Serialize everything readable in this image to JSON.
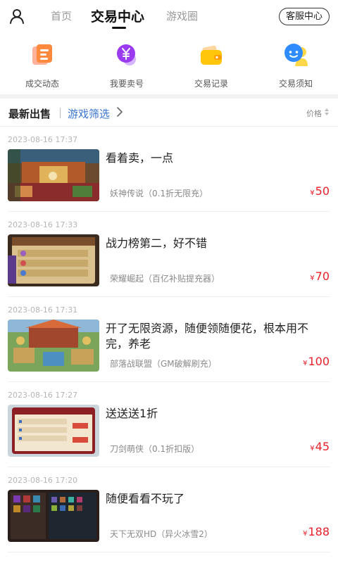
{
  "nav": {
    "user_icon": "user-icon",
    "tabs": [
      {
        "label": "首页"
      },
      {
        "label": "交易中心"
      },
      {
        "label": "游戏圈"
      }
    ],
    "service_label": "客服中心"
  },
  "icon_row": [
    {
      "label": "成交动态",
      "icon": "document-icon"
    },
    {
      "label": "我要卖号",
      "icon": "yen-icon"
    },
    {
      "label": "交易记录",
      "icon": "wallet-icon"
    },
    {
      "label": "交易须知",
      "icon": "chat-user-icon"
    }
  ],
  "filter_bar": {
    "title": "最新出售",
    "filter_label": "游戏筛选",
    "sort_label": "价格"
  },
  "colors": {
    "accent_blue": "#3a74d0",
    "price_red": "#e8212a"
  },
  "listings": [
    {
      "date": "2023-08-16 17:37",
      "title": "看着卖，一点",
      "game": "妖神传说（0.1折无限充）",
      "currency": "¥",
      "price": "50"
    },
    {
      "date": "2023-08-16 17:33",
      "title": "战力榜第二，好不错",
      "game": "荣耀崛起（百亿补贴提充器）",
      "currency": "¥",
      "price": "70"
    },
    {
      "date": "2023-08-16 17:31",
      "title": "开了无限资源，随便领随便花，根本用不完，养老",
      "game": "部落战联盟（GM破解刷充）",
      "currency": "¥",
      "price": "100"
    },
    {
      "date": "2023-08-16 17:27",
      "title": "送送送1折",
      "game": "刀剑萌侠（0.1折扣版）",
      "currency": "¥",
      "price": "45"
    },
    {
      "date": "2023-08-16 17:20",
      "title": "随便看看不玩了",
      "game": "天下无双HD（异火冰雪2）",
      "currency": "¥",
      "price": "188"
    }
  ]
}
